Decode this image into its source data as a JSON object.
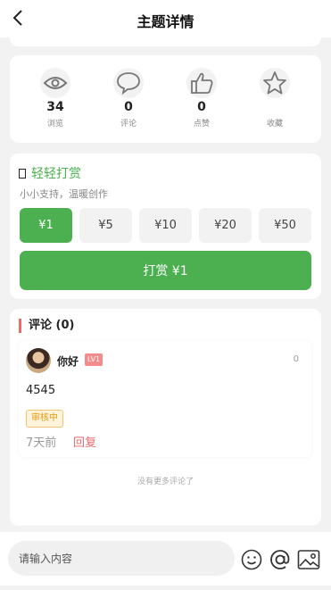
{
  "header": {
    "title": "主题详情",
    "back_icon": "back-arrow-icon"
  },
  "stats": [
    {
      "icon": "eye-icon",
      "value": "34",
      "label": "浏览"
    },
    {
      "icon": "comment-icon",
      "value": "0",
      "label": "评论"
    },
    {
      "icon": "thumbs-up-icon",
      "value": "0",
      "label": "点赞"
    },
    {
      "icon": "star-icon",
      "value": "",
      "label": "收藏"
    }
  ],
  "reward": {
    "title": "轻轻打赏",
    "subtitle": "小小支持，温暖创作",
    "amounts": [
      "¥1",
      "¥5",
      "¥10",
      "¥20",
      "¥50"
    ],
    "selected_index": 0,
    "button_label": "打赏 ¥1",
    "accent_color": "#4caf50"
  },
  "comments": {
    "title": "评论 (0)",
    "items": [
      {
        "username": "你好",
        "level": "LV1",
        "likes": "0",
        "content": "4545",
        "status": "审核中",
        "time": "7天前",
        "reply_label": "回复"
      }
    ],
    "no_more_text": "没有更多评论了"
  },
  "composer": {
    "placeholder": "请输入内容",
    "icons": [
      "emoji-icon",
      "at-icon",
      "image-icon"
    ]
  }
}
